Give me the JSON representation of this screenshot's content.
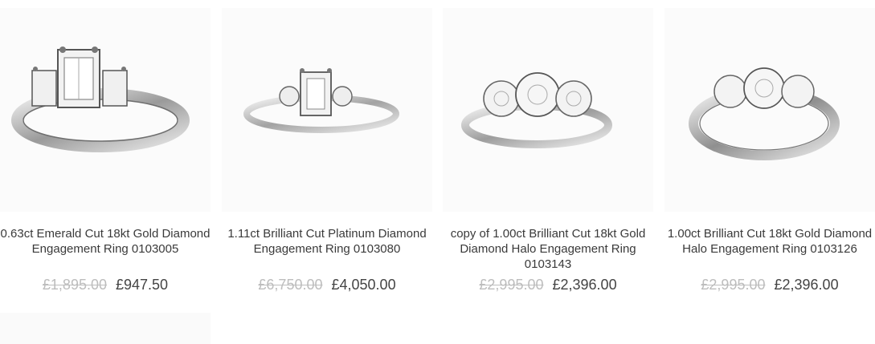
{
  "products": [
    {
      "name": "0.63ct Emerald Cut 18kt Gold Diamond Engagement Ring 0103005",
      "old_price": "£1,895.00",
      "price": "£947.50",
      "image_icon": "ring-three-stone-emerald-icon"
    },
    {
      "name": "1.11ct Brilliant Cut Platinum Diamond Engagement Ring 0103080",
      "old_price": "£6,750.00",
      "price": "£4,050.00",
      "image_icon": "ring-emerald-centre-icon"
    },
    {
      "name": "copy of 1.00ct Brilliant Cut 18kt Gold Diamond Halo Engagement Ring 0103143",
      "old_price": "£2,995.00",
      "price": "£2,396.00",
      "image_icon": "ring-three-round-diamond-icon"
    },
    {
      "name": "1.00ct Brilliant Cut 18kt Gold Diamond Halo Engagement Ring 0103126",
      "old_price": "£2,995.00",
      "price": "£2,396.00",
      "image_icon": "ring-three-round-diamond-icon"
    }
  ],
  "colors": {
    "old_price": "#bdbdbd",
    "price": "#444444",
    "name": "#3a3a3a"
  }
}
